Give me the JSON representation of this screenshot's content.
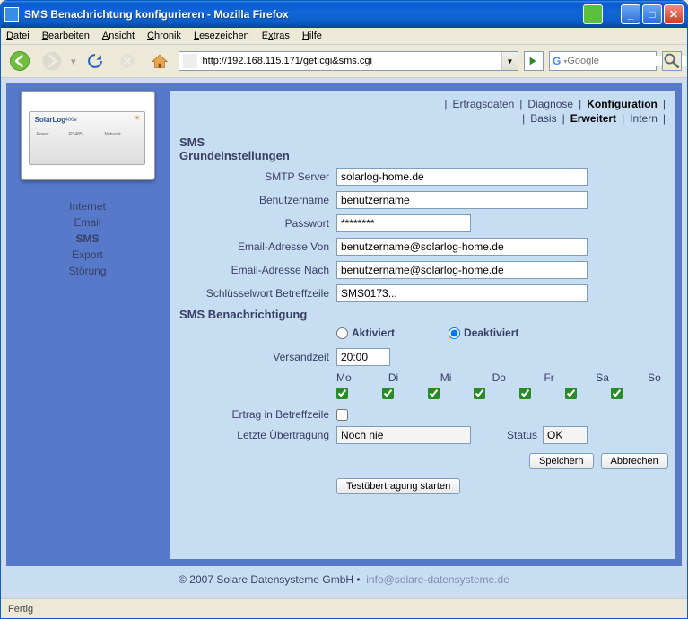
{
  "window": {
    "title": "SMS Benachrichtung konfigurieren - Mozilla Firefox"
  },
  "menubar": [
    "Datei",
    "Bearbeiten",
    "Ansicht",
    "Chronik",
    "Lesezeichen",
    "Extras",
    "Hilfe"
  ],
  "url": "http://192.168.115.171/get.cgi&sms.cgi",
  "search_placeholder": "Google",
  "sidebar": {
    "items": [
      "Internet",
      "Email",
      "SMS",
      "Export",
      "Störung"
    ],
    "active_index": 2,
    "device_label": "SolarLog",
    "device_model": "400e"
  },
  "tabs_primary": [
    "Ertragsdaten",
    "Diagnose",
    "Konfiguration"
  ],
  "tabs_primary_active": 2,
  "tabs_secondary": [
    "Basis",
    "Erweitert",
    "Intern"
  ],
  "tabs_secondary_active": 1,
  "section1_title": "SMS",
  "section1_sub": "Grundeinstellungen",
  "labels": {
    "smtp": "SMTP Server",
    "user": "Benutzername",
    "pass": "Passwort",
    "email_from": "Email-Adresse Von",
    "email_to": "Email-Adresse Nach",
    "keyword": "Schlüsselwort Betreffzeile",
    "section2": "SMS Benachrichtigung",
    "activated": "Aktiviert",
    "deactivated": "Deaktiviert",
    "sendtime": "Versandzeit",
    "ertrag": "Ertrag in Betreffzeile",
    "last_tx": "Letzte Übertragung",
    "status": "Status"
  },
  "values": {
    "smtp": "solarlog-home.de",
    "user": "benutzername",
    "pass": "********",
    "email_from": "benutzername@solarlog-home.de",
    "email_to": "benutzername@solarlog-home.de",
    "keyword": "SMS0173...",
    "sendtime": "20:00",
    "last_tx": "Noch nie",
    "status": "OK"
  },
  "radio_selected": "deactivated",
  "days": [
    "Mo",
    "Di",
    "Mi",
    "Do",
    "Fr",
    "Sa",
    "So"
  ],
  "days_checked": [
    true,
    true,
    true,
    true,
    true,
    true,
    true
  ],
  "ertrag_checked": false,
  "buttons": {
    "save": "Speichern",
    "cancel": "Abbrechen",
    "test": "Testübertragung starten"
  },
  "footer": {
    "copyright": "© 2007 Solare Datensysteme GmbH •",
    "email": "info@solare-datensysteme.de"
  },
  "statusbar": "Fertig"
}
